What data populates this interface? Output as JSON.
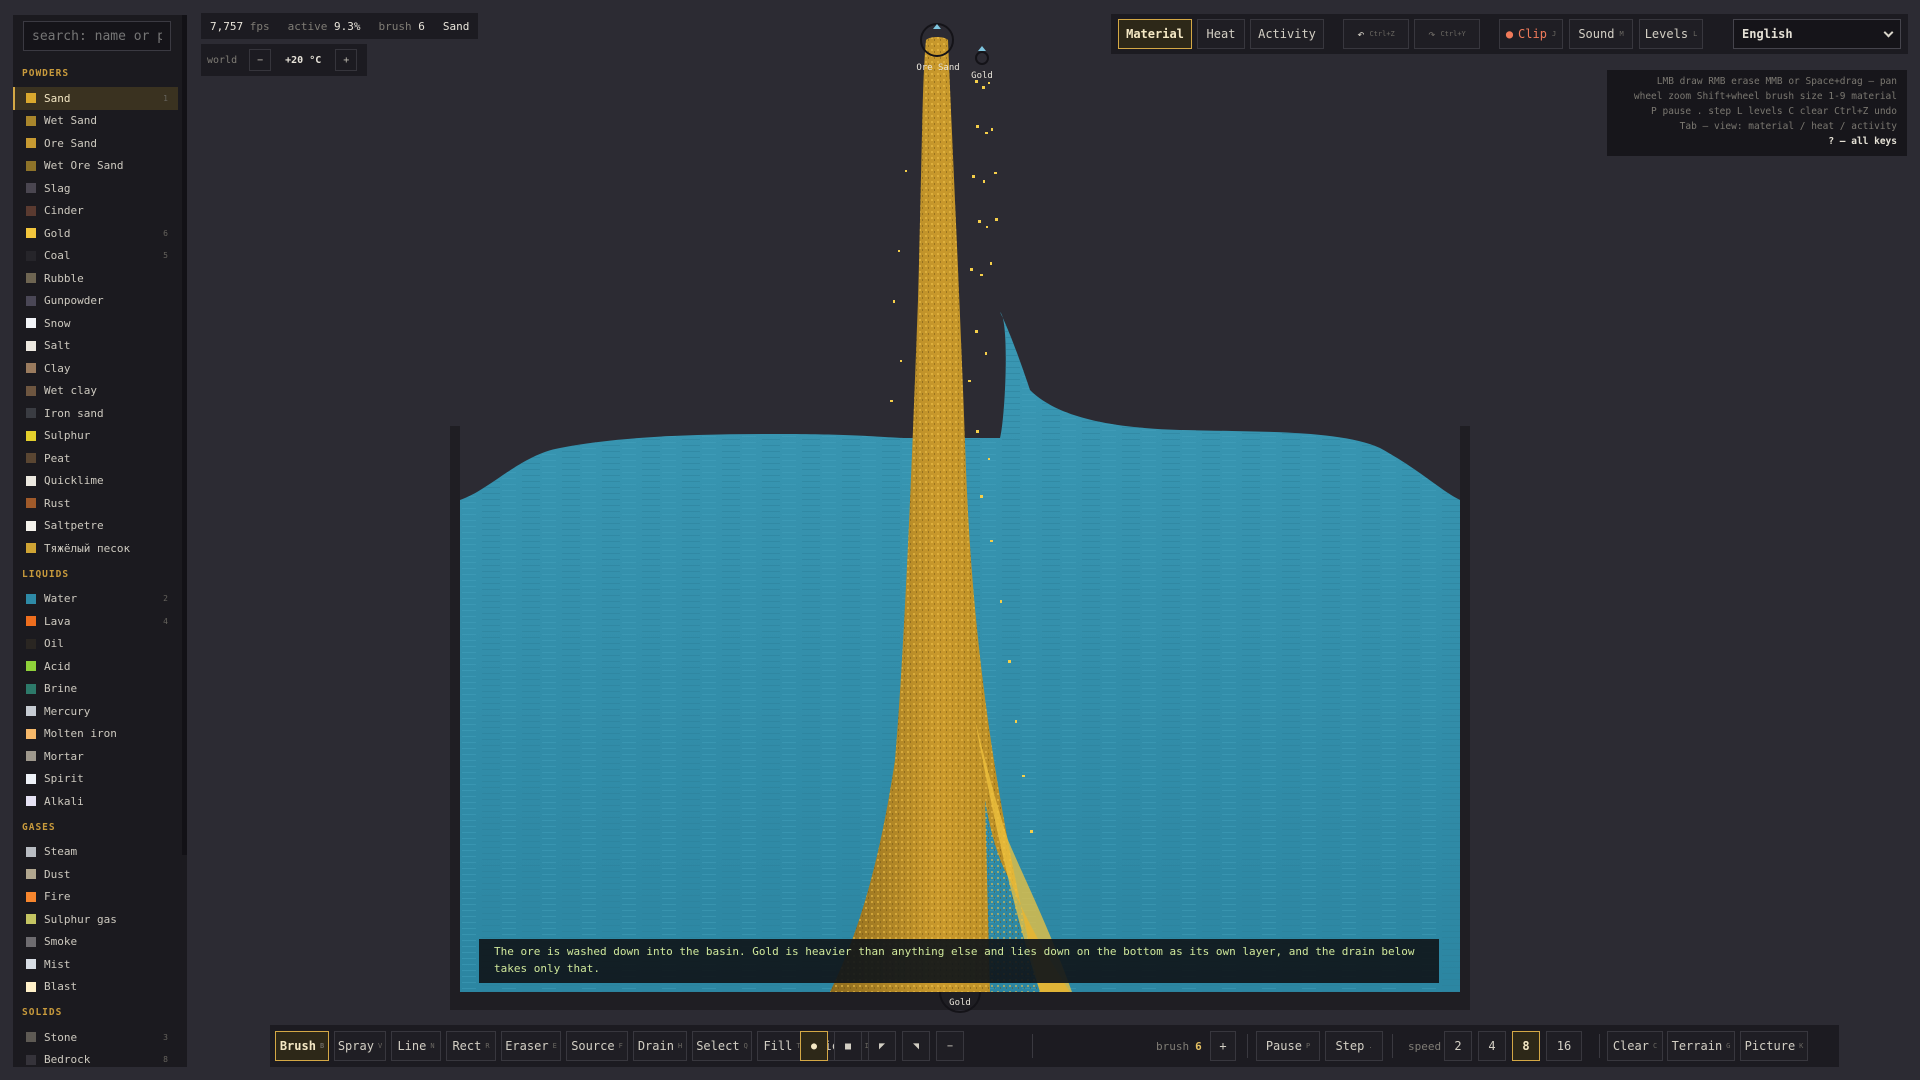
{
  "sidebar": {
    "search_placeholder": "search: name or prope",
    "categories": [
      {
        "title": "POWDERS",
        "items": [
          {
            "name": "Sand",
            "color": "#d9a82e",
            "key": "1",
            "active": true
          },
          {
            "name": "Wet Sand",
            "color": "#a9862c",
            "key": ""
          },
          {
            "name": "Ore Sand",
            "color": "#c79a32",
            "key": ""
          },
          {
            "name": "Wet Ore Sand",
            "color": "#8e7329",
            "key": ""
          },
          {
            "name": "Slag",
            "color": "#4a4650",
            "key": ""
          },
          {
            "name": "Cinder",
            "color": "#5a3a30",
            "key": ""
          },
          {
            "name": "Gold",
            "color": "#f2c63d",
            "key": "6"
          },
          {
            "name": "Coal",
            "color": "#26252a",
            "key": "5"
          },
          {
            "name": "Rubble",
            "color": "#6e6552",
            "key": ""
          },
          {
            "name": "Gunpowder",
            "color": "#4a4756",
            "key": ""
          },
          {
            "name": "Snow",
            "color": "#f2f4f8",
            "key": ""
          },
          {
            "name": "Salt",
            "color": "#ece8e0",
            "key": ""
          },
          {
            "name": "Clay",
            "color": "#9a7b5e",
            "key": ""
          },
          {
            "name": "Wet clay",
            "color": "#6e5640",
            "key": ""
          },
          {
            "name": "Iron sand",
            "color": "#3a3c42",
            "key": ""
          },
          {
            "name": "Sulphur",
            "color": "#e3cf2c",
            "key": ""
          },
          {
            "name": "Peat",
            "color": "#5a4632",
            "key": ""
          },
          {
            "name": "Quicklime",
            "color": "#ebe8df",
            "key": ""
          },
          {
            "name": "Rust",
            "color": "#a05a2a",
            "key": ""
          },
          {
            "name": "Saltpetre",
            "color": "#f4f2ec",
            "key": ""
          },
          {
            "name": "Тяжёлый песок",
            "color": "#cfa434",
            "key": ""
          }
        ]
      },
      {
        "title": "LIQUIDS",
        "items": [
          {
            "name": "Water",
            "color": "#2e8aa6",
            "key": "2"
          },
          {
            "name": "Lava",
            "color": "#ee6e1e",
            "key": "4"
          },
          {
            "name": "Oil",
            "color": "#2a2622",
            "key": ""
          },
          {
            "name": "Acid",
            "color": "#8fd13a",
            "key": ""
          },
          {
            "name": "Brine",
            "color": "#2d7a6a",
            "key": ""
          },
          {
            "name": "Mercury",
            "color": "#c6cbd2",
            "key": ""
          },
          {
            "name": "Molten iron",
            "color": "#f6b86a",
            "key": ""
          },
          {
            "name": "Mortar",
            "color": "#9e988c",
            "key": ""
          },
          {
            "name": "Spirit",
            "color": "#eef2f8",
            "key": ""
          },
          {
            "name": "Alkali",
            "color": "#e6e2f4",
            "key": ""
          }
        ]
      },
      {
        "title": "GASES",
        "items": [
          {
            "name": "Steam",
            "color": "#b8bcc2",
            "key": ""
          },
          {
            "name": "Dust",
            "color": "#b1a68e",
            "key": ""
          },
          {
            "name": "Fire",
            "color": "#f7862e",
            "key": ""
          },
          {
            "name": "Sulphur gas",
            "color": "#c4c462",
            "key": ""
          },
          {
            "name": "Smoke",
            "color": "#6e6c70",
            "key": ""
          },
          {
            "name": "Mist",
            "color": "#d8dde4",
            "key": ""
          },
          {
            "name": "Blast",
            "color": "#fff0c8",
            "key": ""
          }
        ]
      },
      {
        "title": "SOLIDS",
        "items": [
          {
            "name": "Stone",
            "color": "#5e5a54",
            "key": "3"
          },
          {
            "name": "Bedrock",
            "color": "#35333a",
            "key": "8"
          }
        ]
      }
    ]
  },
  "stats": {
    "fps_value": "7,757",
    "fps_label": "fps",
    "active_label": "active",
    "active_value": "9.3%",
    "brush_label": "brush",
    "brush_value": "6",
    "material": "Sand"
  },
  "world": {
    "label": "world",
    "minus": "−",
    "temperature": "+20 °C",
    "plus": "+"
  },
  "topbar": {
    "material": "Material",
    "heat": "Heat",
    "activity": "Activity",
    "undo": "↶",
    "undo_key": "Ctrl+Z",
    "redo": "↷",
    "redo_key": "Ctrl+Y",
    "clip_dot": "●",
    "clip": "Clip",
    "clip_key": "J",
    "sound": "Sound",
    "sound_key": "M",
    "levels": "Levels",
    "levels_key": "L",
    "language": "English"
  },
  "help": {
    "line1": "LMB draw   RMB erase   MMB or Space+drag — pan",
    "line2": "wheel zoom   Shift+wheel brush size   1-9 material",
    "line3": "P pause   . step   L levels   C clear   Ctrl+Z undo",
    "line4": "Tab — view: material / heat / activity",
    "line5": "? — all keys"
  },
  "markers": {
    "source_ore": "Ore Sand",
    "source_gold": "Gold",
    "drain": "Gold"
  },
  "narration": "The ore is washed down into the basin. Gold is heavier than anything else and lies down on the bottom as its own layer, and the drain below takes only that.",
  "bottombar": {
    "tools": [
      {
        "label": "Brush",
        "key": "B",
        "selected": true
      },
      {
        "label": "Spray",
        "key": "V"
      },
      {
        "label": "Line",
        "key": "N"
      },
      {
        "label": "Rect",
        "key": "R"
      },
      {
        "label": "Eraser",
        "key": "E"
      },
      {
        "label": "Source",
        "key": "F"
      },
      {
        "label": "Drain",
        "key": "H"
      },
      {
        "label": "Select",
        "key": "Q"
      },
      {
        "label": "Fill",
        "key": "T"
      },
      {
        "label": "Picker",
        "key": "I"
      }
    ],
    "shapes": [
      "●",
      "■",
      "◤",
      "◥",
      "−"
    ],
    "brush_label": "brush",
    "brush_value": "6",
    "brush_plus": "+",
    "pause": "Pause",
    "pause_key": "P",
    "step": "Step",
    "step_key": ".",
    "speed_label": "speed",
    "speeds": [
      "2",
      "4",
      "8",
      "16"
    ],
    "speed_selected": "8",
    "clear": "Clear",
    "clear_key": "C",
    "terrain": "Terrain",
    "terrain_key": "G",
    "picture": "Picture",
    "picture_key": "K"
  }
}
